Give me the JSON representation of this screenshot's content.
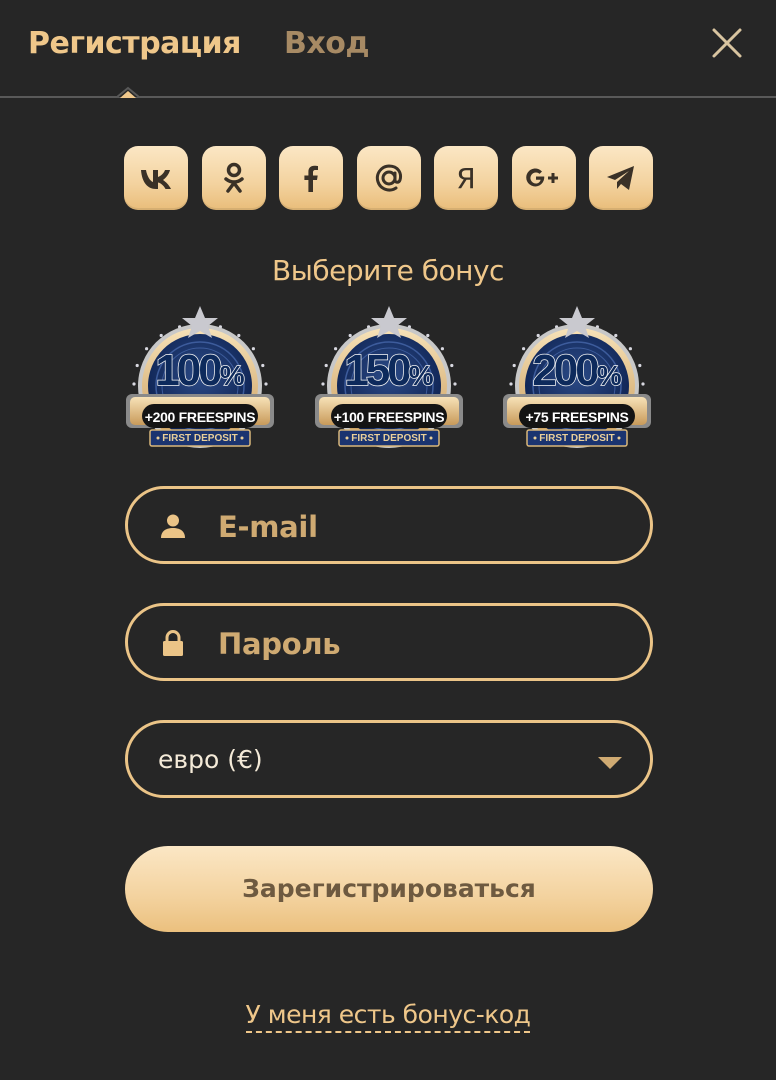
{
  "tabs": {
    "register_label": "Регистрация",
    "login_label": "Вход"
  },
  "social": [
    {
      "name": "vk",
      "label": "vk"
    },
    {
      "name": "odnoklassniki",
      "label": "ok"
    },
    {
      "name": "facebook",
      "label": "f"
    },
    {
      "name": "mail-ru",
      "label": "@"
    },
    {
      "name": "yandex",
      "label": "Я"
    },
    {
      "name": "google-plus",
      "label": "G+"
    },
    {
      "name": "telegram",
      "label": "telegram"
    }
  ],
  "bonus": {
    "title": "Выберите бонус",
    "options": [
      {
        "percent": "100",
        "freespins": "+200 FREESPINS",
        "caption": "FIRST DEPOSIT"
      },
      {
        "percent": "150",
        "freespins": "+100 FREESPINS",
        "caption": "FIRST DEPOSIT"
      },
      {
        "percent": "200",
        "freespins": "+75 FREESPINS",
        "caption": "FIRST DEPOSIT"
      }
    ]
  },
  "form": {
    "email_placeholder": "E-mail",
    "password_placeholder": "Пароль",
    "currency_value": "евро (€)",
    "submit_label": "Зарегистрироваться",
    "promo_link": "У меня есть бонус-код"
  },
  "colors": {
    "background": "#262626",
    "accent": "#efc78a",
    "accent_dim": "#a78a64",
    "badge_blue": "#0d2a5c"
  }
}
